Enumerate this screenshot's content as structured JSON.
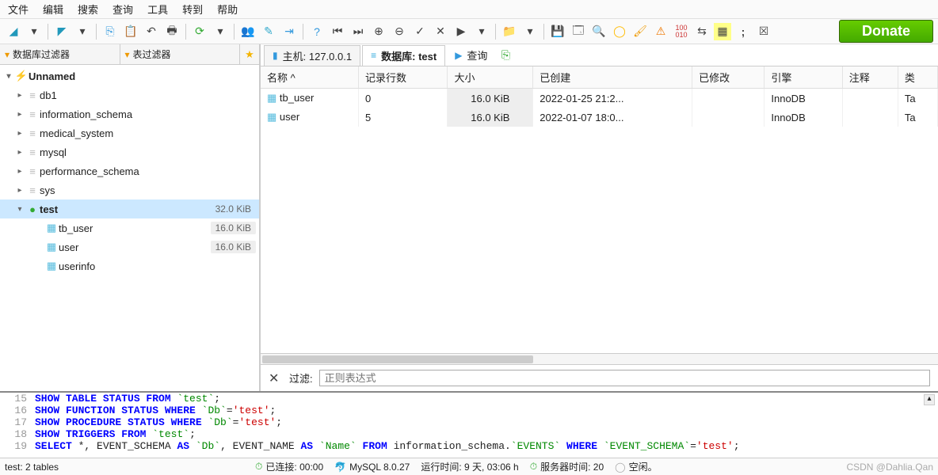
{
  "menu": [
    "文件",
    "编辑",
    "搜索",
    "查询",
    "工具",
    "转到",
    "帮助"
  ],
  "donate_label": "Donate",
  "filter_tabs": {
    "db": "数据库过滤器",
    "tbl": "表过滤器"
  },
  "tree": {
    "root": {
      "label": "Unnamed"
    },
    "dbs": [
      {
        "label": "db1"
      },
      {
        "label": "information_schema"
      },
      {
        "label": "medical_system"
      },
      {
        "label": "mysql"
      },
      {
        "label": "performance_schema"
      },
      {
        "label": "sys"
      }
    ],
    "selected": {
      "label": "test",
      "size": "32.0 KiB"
    },
    "children": [
      {
        "label": "tb_user",
        "size": "16.0 KiB"
      },
      {
        "label": "user",
        "size": "16.0 KiB"
      },
      {
        "label": "userinfo",
        "size": ""
      }
    ]
  },
  "tabs": {
    "host": {
      "prefix": "主机:",
      "value": "127.0.0.1"
    },
    "db": {
      "prefix": "数据库:",
      "value": "test"
    },
    "query": "查询"
  },
  "table": {
    "headers": [
      "名称 ^",
      "记录行数",
      "大小",
      "已创建",
      "已修改",
      "引擎",
      "注释",
      "类"
    ],
    "rows": [
      {
        "name": "tb_user",
        "rows": "0",
        "size": "16.0 KiB",
        "created": "2022-01-25 21:2...",
        "modified": "",
        "engine": "InnoDB",
        "comment": "",
        "type": "Ta"
      },
      {
        "name": "user",
        "rows": "5",
        "size": "16.0 KiB",
        "created": "2022-01-07 18:0...",
        "modified": "",
        "engine": "InnoDB",
        "comment": "",
        "type": "Ta"
      }
    ]
  },
  "filterbar": {
    "label": "过滤:",
    "placeholder": "正则表达式"
  },
  "sql": {
    "lines": [
      {
        "n": "15",
        "html": "<span class='kw'>SHOW TABLE STATUS FROM</span> <span class='id'>`test`</span>;"
      },
      {
        "n": "16",
        "html": "<span class='kw'>SHOW FUNCTION STATUS WHERE</span> <span class='id'>`Db`</span>=<span class='str'>'test'</span>;"
      },
      {
        "n": "17",
        "html": "<span class='kw'>SHOW PROCEDURE STATUS WHERE</span> <span class='id'>`Db`</span>=<span class='str'>'test'</span>;"
      },
      {
        "n": "18",
        "html": "<span class='kw'>SHOW TRIGGERS FROM</span> <span class='id'>`test`</span>;"
      },
      {
        "n": "19",
        "html": "<span class='kw'>SELECT</span> *, EVENT_SCHEMA <span class='kw'>AS</span> <span class='id'>`Db`</span>, EVENT_NAME <span class='kw'>AS</span> <span class='id'>`Name`</span> <span class='kw'>FROM</span> information_schema.<span class='id'>`EVENTS`</span> <span class='kw'>WHERE</span> <span class='id'>`EVENT_SCHEMA`</span>=<span class='str'>'test'</span>;"
      }
    ]
  },
  "status": {
    "left": "test: 2 tables",
    "connected": "已连接: 00:00",
    "server": "MySQL 8.0.27",
    "uptime": "运行时间: 9 天, 03:06 h",
    "servertime": "服务器时间: 20",
    "idle": "空闲。",
    "watermark": "CSDN @Dahlia.Qan"
  }
}
